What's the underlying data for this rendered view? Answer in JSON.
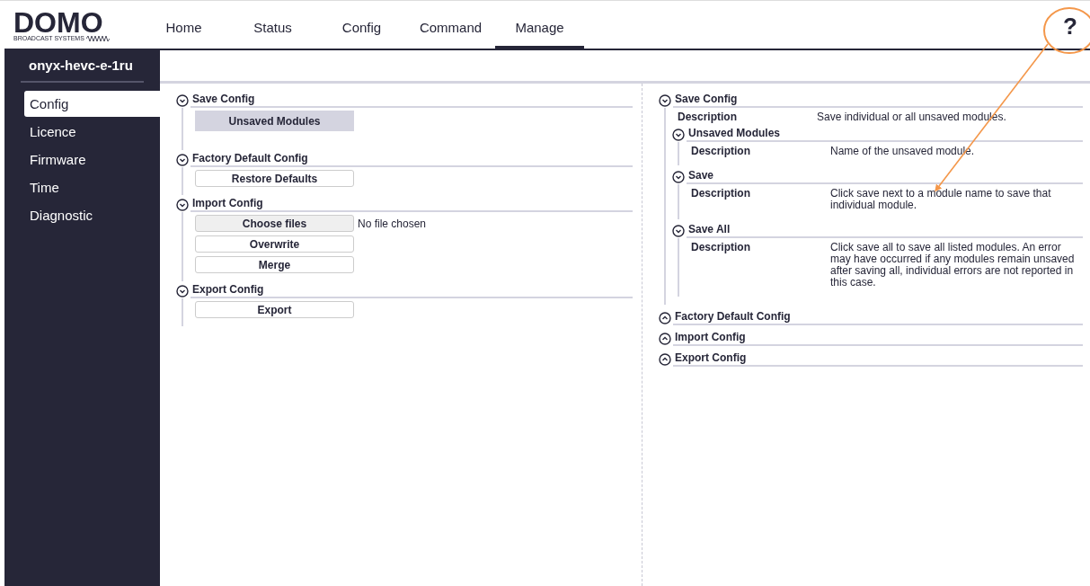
{
  "logo": {
    "wordmark": "DOMO",
    "tagline": "BROADCAST SYSTEMS"
  },
  "nav": [
    {
      "label": "Home",
      "selected": false
    },
    {
      "label": "Status",
      "selected": false
    },
    {
      "label": "Config",
      "selected": false
    },
    {
      "label": "Command",
      "selected": false
    },
    {
      "label": "Manage",
      "selected": true
    }
  ],
  "help": "?",
  "sidebar": {
    "device": "onyx-hevc-e-1ru",
    "items": [
      {
        "label": "Config",
        "selected": true
      },
      {
        "label": "Licence",
        "selected": false
      },
      {
        "label": "Firmware",
        "selected": false
      },
      {
        "label": "Time",
        "selected": false
      },
      {
        "label": "Diagnostic",
        "selected": false
      }
    ]
  },
  "sections": [
    {
      "title": "Save Config",
      "expanded": true,
      "controls": [
        {
          "kind": "tab",
          "label": "Unsaved Modules"
        }
      ]
    },
    {
      "title": "Factory Default Config",
      "expanded": true,
      "controls": [
        {
          "kind": "button",
          "label": "Restore Defaults"
        }
      ]
    },
    {
      "title": "Import Config",
      "expanded": true,
      "controls": [
        {
          "kind": "file",
          "label": "Choose files",
          "status": "No file chosen"
        },
        {
          "kind": "button",
          "label": "Overwrite"
        },
        {
          "kind": "button",
          "label": "Merge"
        }
      ]
    },
    {
      "title": "Export Config",
      "expanded": true,
      "controls": [
        {
          "kind": "button",
          "label": "Export"
        }
      ]
    }
  ],
  "help_panel": [
    {
      "title": "Save Config",
      "expanded": true,
      "label": "Description",
      "text": "Save individual or all unsaved modules.",
      "children": [
        {
          "title": "Unsaved Modules",
          "expanded": true,
          "label": "Description",
          "text": "Name of the unsaved module."
        },
        {
          "title": "Save",
          "expanded": true,
          "label": "Description",
          "text": "Click save next to a module name to save that individual module."
        },
        {
          "title": "Save All",
          "expanded": true,
          "label": "Description",
          "text": "Click save all to save all listed modules. An error may have occurred if any modules remain unsaved after saving all, individual errors are not reported in this case."
        }
      ]
    },
    {
      "title": "Factory Default Config",
      "expanded": false
    },
    {
      "title": "Import Config",
      "expanded": false
    },
    {
      "title": "Export Config",
      "expanded": false
    }
  ]
}
